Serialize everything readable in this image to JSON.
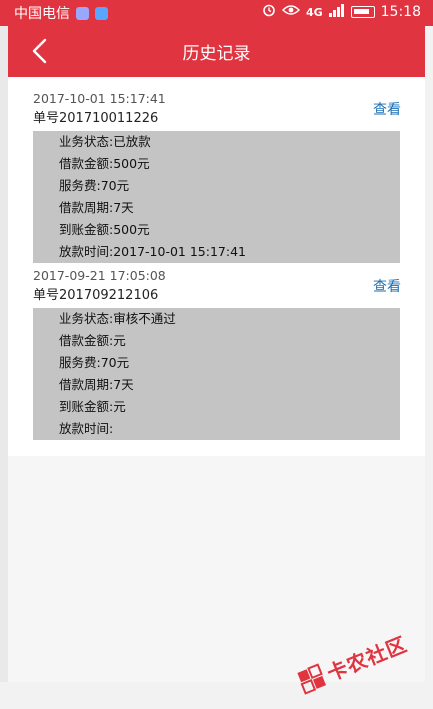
{
  "status_bar": {
    "carrier": "中国电信",
    "network": "4G",
    "time": "15:18"
  },
  "header": {
    "title": "历史记录",
    "back_icon": "chevron-left-icon"
  },
  "records": [
    {
      "timestamp": "2017-10-01 15:17:41",
      "order_no": "单号201710011226",
      "view_label": "查看",
      "lines": [
        "业务状态:已放款",
        "借款金额:500元",
        "服务费:70元",
        "借款周期:7天",
        "到账金额:500元",
        "放款时间:2017-10-01 15:17:41"
      ]
    },
    {
      "timestamp": "2017-09-21 17:05:08",
      "order_no": "单号201709212106",
      "view_label": "查看",
      "lines": [
        "业务状态:审核不通过",
        "借款金额:元",
        "服务费:70元",
        "借款周期:7天",
        "到账金额:元",
        "放款时间:"
      ]
    }
  ],
  "watermark": {
    "text": "卡农社区"
  },
  "colors": {
    "accent": "#e03440",
    "link": "#1a6fb5",
    "detail_bg": "#c4c4c4"
  }
}
